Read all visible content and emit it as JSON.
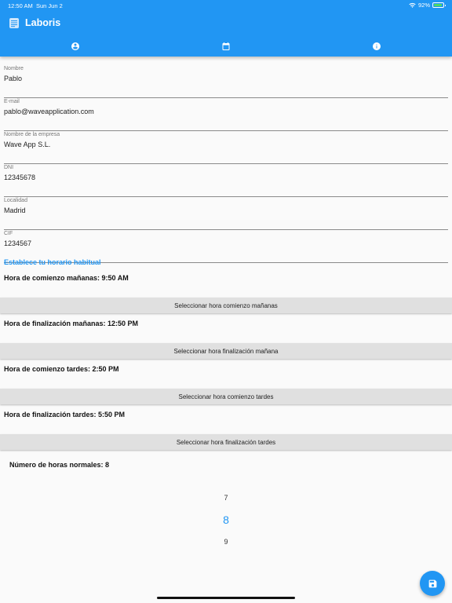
{
  "status_bar": {
    "time": "12:50 AM",
    "date": "Sun Jun 2",
    "battery": "92%",
    "battery_level": 0.92
  },
  "app": {
    "title": "Laboris",
    "icon": "notes-icon"
  },
  "tabs": [
    {
      "icon": "account-circle-icon",
      "selected": true
    },
    {
      "icon": "calendar-icon",
      "selected": false
    },
    {
      "icon": "info-icon",
      "selected": false
    }
  ],
  "fields": [
    {
      "label": "Nombre",
      "value": "Pablo"
    },
    {
      "label": "E-mail",
      "value": "pablo@waveapplication.com"
    },
    {
      "label": "Nombre de la empresa",
      "value": "Wave App S.L."
    },
    {
      "label": "DNI",
      "value": "12345678"
    },
    {
      "label": "Localidad",
      "value": "Madrid"
    },
    {
      "label": "CIF",
      "value": "1234567"
    }
  ],
  "schedule": {
    "title": "Establece tu horario habitual",
    "rows": [
      {
        "label": "Hora de comienzo mañanas: 9:50 AM",
        "button": "Seleccionar hora comienzo mañanas"
      },
      {
        "label": "Hora de finalización mañanas: 12:50 PM",
        "button": "Seleccionar hora finalización mañana"
      },
      {
        "label": "Hora de comienzo tardes: 2:50 PM",
        "button": "Seleccionar hora comienzo tardes"
      },
      {
        "label": "Hora de finalización tardes: 5:50 PM",
        "button": "Seleccionar hora finalización tardes"
      }
    ]
  },
  "hours": {
    "label": "Número de horas normales: 8",
    "picker": [
      "7",
      "8",
      "9"
    ],
    "selected": "8"
  },
  "colors": {
    "primary": "#2196f3",
    "battery": "#4cd964",
    "button_bg": "#e0e0e0"
  },
  "fab": {
    "icon": "save-icon"
  }
}
